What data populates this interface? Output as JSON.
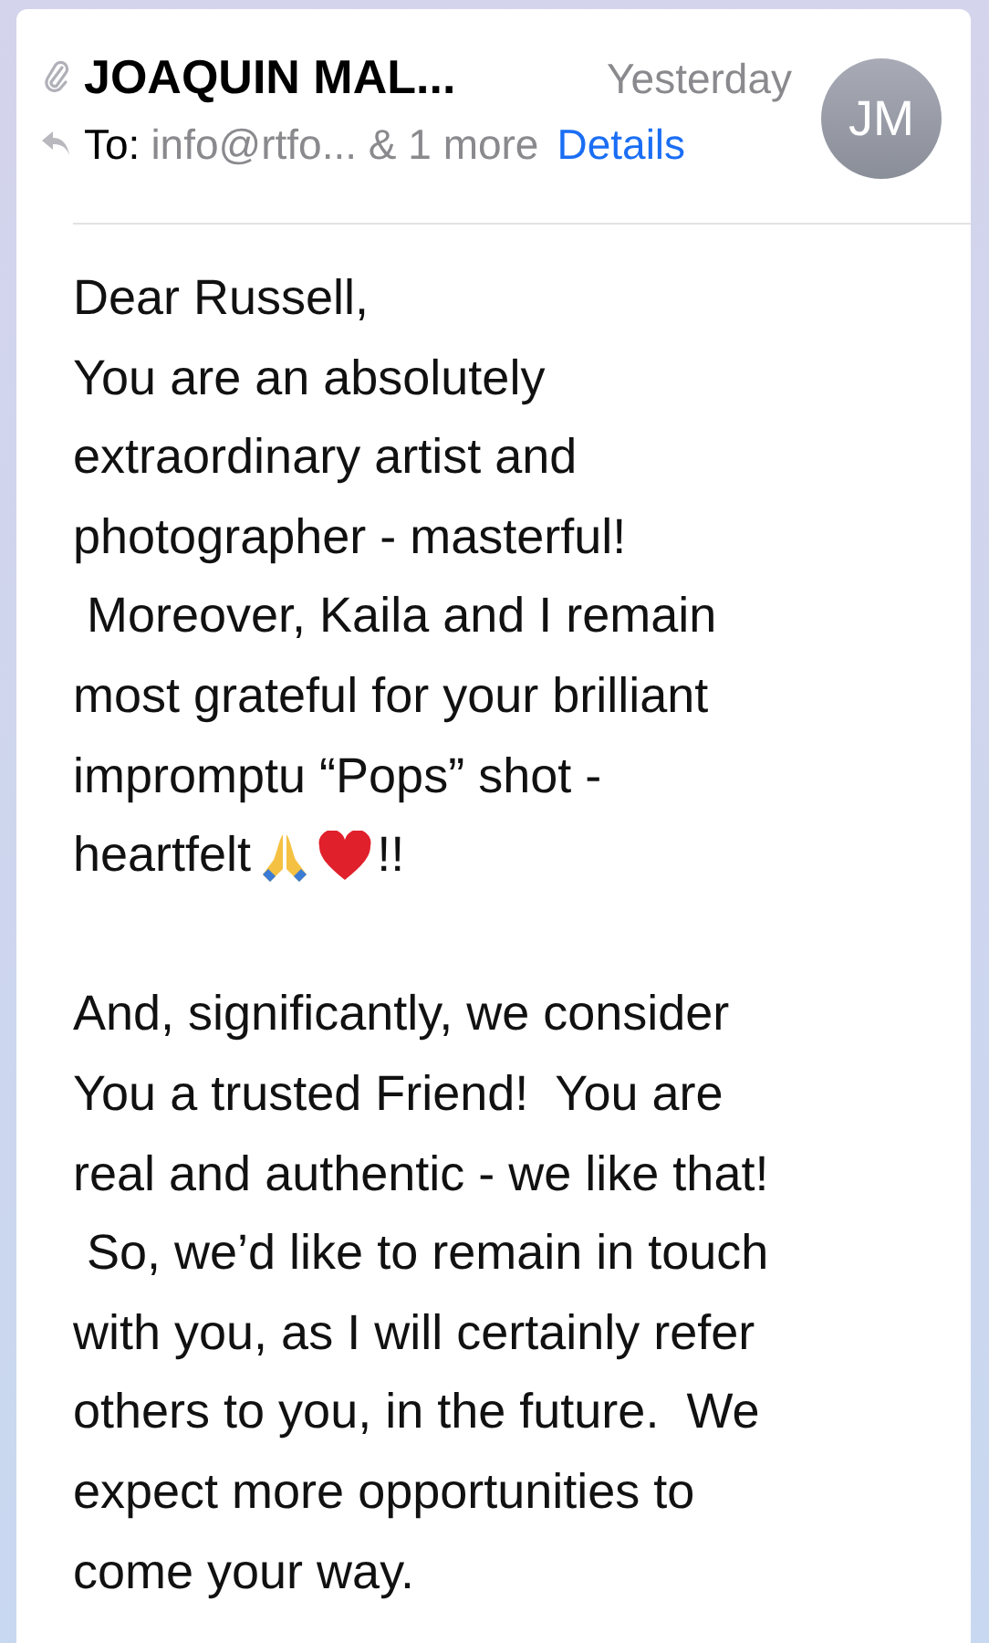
{
  "header": {
    "sender": "JOAQUIN MAL...",
    "date": "Yesterday",
    "to_label": "To:",
    "recipients": "info@rtfo... & 1 more",
    "details": "Details",
    "avatar": "JM"
  },
  "body": [
    {
      "kind": "text",
      "text": "Dear Russell,"
    },
    {
      "kind": "text",
      "text": "You are an absolutely"
    },
    {
      "kind": "text",
      "text": "extraordinary artist and"
    },
    {
      "kind": "text",
      "text": "photographer - masterful!"
    },
    {
      "kind": "text",
      "text": " Moreover, Kaila and I remain"
    },
    {
      "kind": "text",
      "text": "most grateful for your brilliant"
    },
    {
      "kind": "text",
      "text": "impromptu “Pops” shot -"
    },
    {
      "kind": "emoji",
      "before": "heartfelt",
      "after": "!!"
    },
    {
      "kind": "blank"
    },
    {
      "kind": "text",
      "text": "And, significantly, we consider"
    },
    {
      "kind": "text",
      "text": "You a trusted Friend!  You are"
    },
    {
      "kind": "text",
      "text": "real and authentic - we like that!"
    },
    {
      "kind": "text",
      "text": " So, we’d like to remain in touch"
    },
    {
      "kind": "text",
      "text": "with you, as I will certainly refer"
    },
    {
      "kind": "text",
      "text": "others to you, in the future.  We"
    },
    {
      "kind": "text",
      "text": "expect more opportunities to"
    },
    {
      "kind": "text",
      "text": "come your way."
    }
  ]
}
